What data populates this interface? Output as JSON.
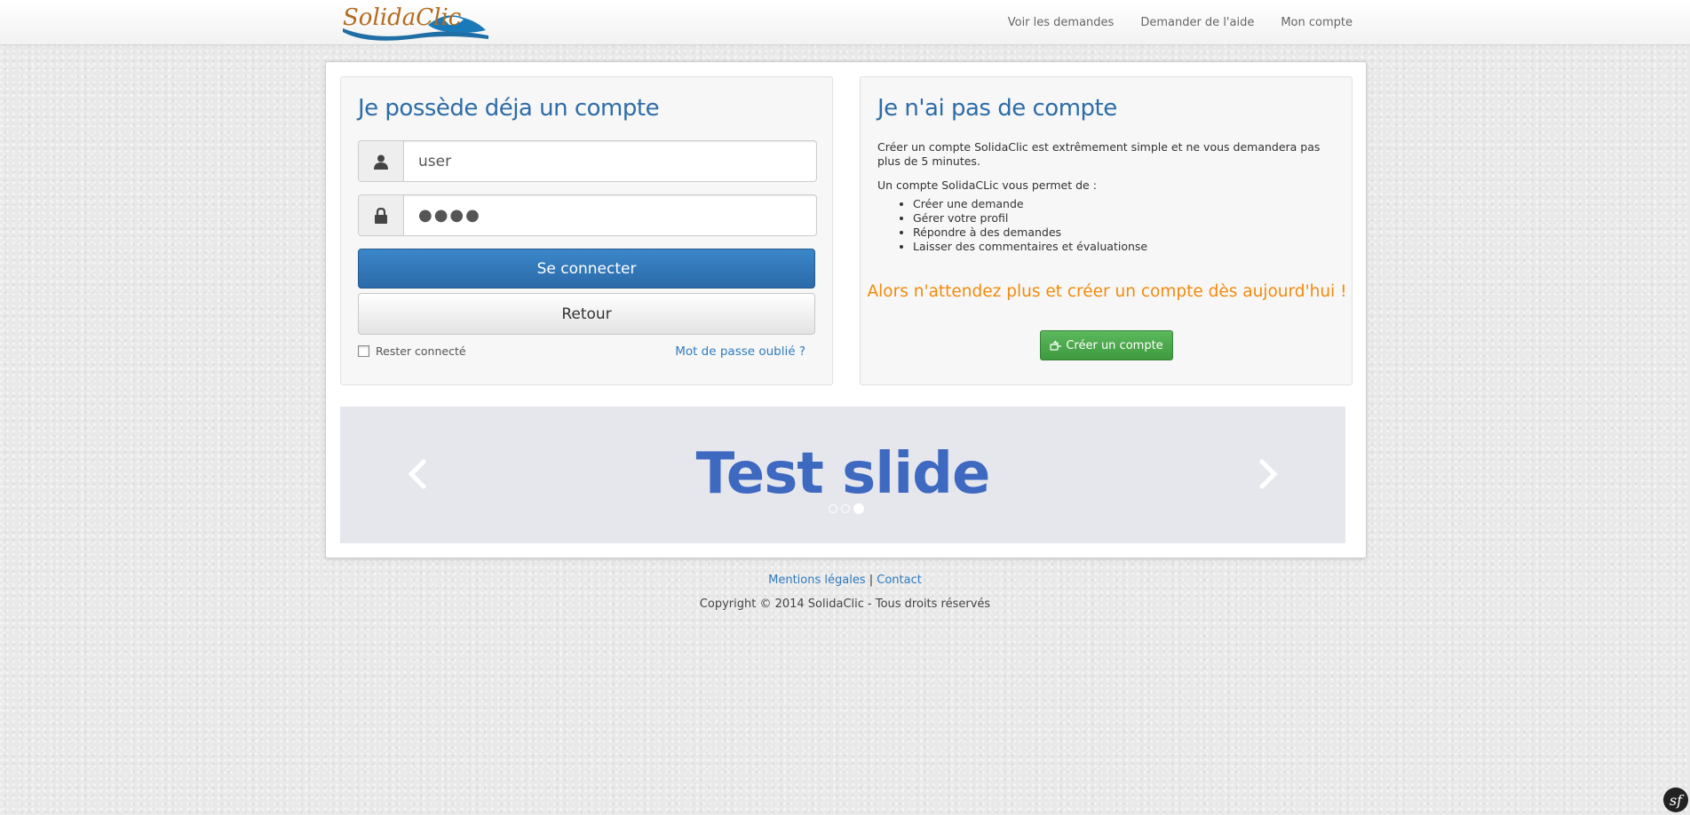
{
  "header": {
    "logo_text": "SolidaClic",
    "nav": [
      {
        "label": "Voir les demandes"
      },
      {
        "label": "Demander de l'aide"
      },
      {
        "label": "Mon compte"
      }
    ]
  },
  "login": {
    "title": "Je possède déja un compte",
    "username_value": "user",
    "password_value": "●●●●",
    "submit_label": "Se connecter",
    "back_label": "Retour",
    "remember_label": "Rester connecté",
    "forgot_label": "Mot de passe oublié ?"
  },
  "register": {
    "title": "Je n'ai pas de compte",
    "intro": "Créer un compte SolidaClic est extrêmement simple et ne vous demandera pas plus de 5 minutes.",
    "list_intro": "Un compte SolidaCLic vous permet de :",
    "features": [
      "Créer une demande",
      "Gérer votre profil",
      "Répondre à des demandes",
      "Laisser des commentaires et évaluationse"
    ],
    "cta": "Alors n'attendez plus et créer un compte dès aujourd'hui !",
    "button_label": "Créer un compte",
    "button_icon": "hand-pointer-icon"
  },
  "carousel": {
    "slide_title": "Test slide",
    "slide_count": 3,
    "active_index": 2
  },
  "footer": {
    "legal_label": "Mentions légales",
    "separator": "|",
    "contact_label": "Contact",
    "copyright": "Copyright © 2014 SolidaClic - Tous droits réservés"
  },
  "debug_badge": "sf",
  "colors": {
    "brand_blue": "#2d6ca8",
    "primary_button": "#337ab7",
    "success_button": "#5cb85c",
    "cta_orange": "#f28b0c",
    "slide_text": "#3e69c1"
  }
}
